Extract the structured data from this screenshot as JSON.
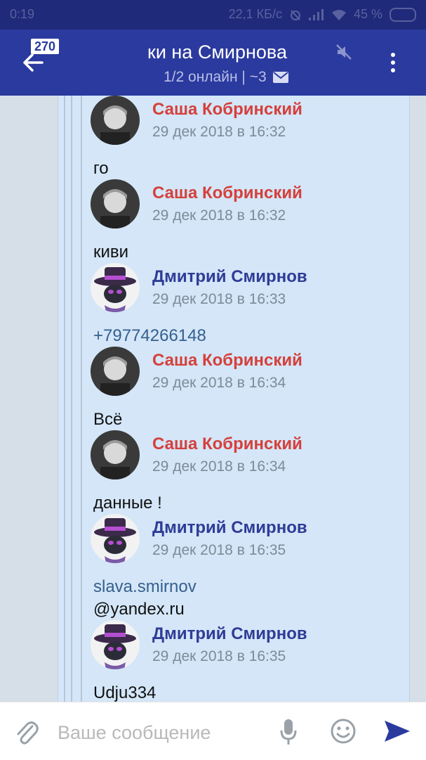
{
  "status_bar": {
    "time": "0:19",
    "speed": "22,1 КБ/с",
    "battery": "45 %"
  },
  "app_bar": {
    "unread_badge": "270",
    "title": "ки на Смирнова",
    "subtitle": "1/2 онлайн | ~3",
    "icons": [
      "back-arrow-icon",
      "mute-icon",
      "envelope-icon",
      "more-vert-icon"
    ]
  },
  "colors": {
    "app_bar": "#2b3a9e",
    "status_bar": "#1f2a7a",
    "panel": "#d4e6f8",
    "name_red": "#d5403b",
    "name_blue": "#2f3c96",
    "link": "#35608f",
    "send": "#2b3a9e"
  },
  "messages": [
    {
      "author": "Саша Кобринский",
      "date": "29 дек 2018 в 16:32",
      "text": "го",
      "avatar": "boy-photo",
      "author_color": "red"
    },
    {
      "author": "Саша Кобринский",
      "date": "29 дек 2018 в 16:32",
      "text": "киви",
      "avatar": "boy-photo",
      "author_color": "red"
    },
    {
      "author": "Дмитрий Смирнов",
      "date": "29 дек 2018 в 16:33",
      "text": "+79774266148",
      "avatar": "hat-character",
      "author_color": "blue",
      "is_link": true
    },
    {
      "author": "Саша Кобринский",
      "date": "29 дек 2018 в 16:34",
      "text": "Всё",
      "avatar": "boy-photo",
      "author_color": "red"
    },
    {
      "author": "Саша Кобринский",
      "date": "29 дек 2018 в 16:34",
      "text": "данные !",
      "avatar": "boy-photo",
      "author_color": "red"
    },
    {
      "author": "Дмитрий Смирнов",
      "date": "29 дек 2018 в 16:35",
      "text": "slava.smirnov",
      "text2": "@yandex.ru",
      "avatar": "hat-character",
      "author_color": "blue"
    },
    {
      "author": "Дмитрий Смирнов",
      "date": "29 дек 2018 в 16:35",
      "text": "Udju334",
      "avatar": "hat-character",
      "author_color": "blue"
    }
  ],
  "composer": {
    "placeholder": "Ваше сообщение",
    "value": "",
    "icons": [
      "paperclip-icon",
      "microphone-icon",
      "emoji-icon",
      "send-icon"
    ]
  }
}
